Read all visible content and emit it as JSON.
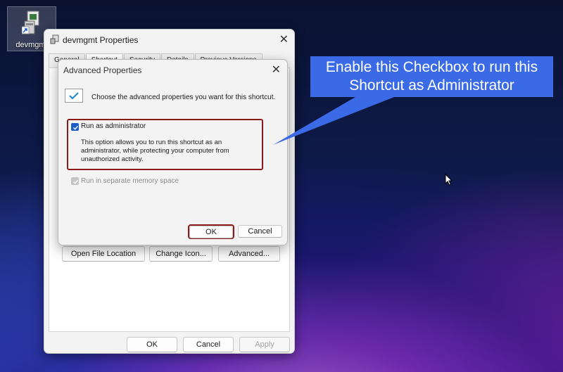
{
  "desktop": {
    "icon_label": "devmgmt"
  },
  "back_dialog": {
    "title": "devmgmt Properties",
    "tabs": [
      "General",
      "Shortcut",
      "Security",
      "Details",
      "Previous Versions"
    ],
    "buttons": {
      "open_file_location": "Open File Location",
      "change_icon": "Change Icon...",
      "advanced": "Advanced..."
    },
    "footer": {
      "ok": "OK",
      "cancel": "Cancel",
      "apply": "Apply"
    }
  },
  "advanced_dialog": {
    "title": "Advanced Properties",
    "description": "Choose the advanced properties you want for this shortcut.",
    "run_as_admin": {
      "label": "Run as administrator",
      "checked": true,
      "description": "This option allows you to run this shortcut as an administrator, while protecting your computer from unauthorized activity."
    },
    "separate_memory": {
      "label": "Run in separate memory space",
      "checked": true,
      "enabled": false
    },
    "ok": "OK",
    "cancel": "Cancel"
  },
  "callout": {
    "line1": "Enable this Checkbox to run this",
    "line2": "Shortcut as Administrator"
  },
  "colors": {
    "callout": "#3a6ae6",
    "highlight": "#8b1a1a",
    "checkbox_accent": "#1a5ec6"
  }
}
